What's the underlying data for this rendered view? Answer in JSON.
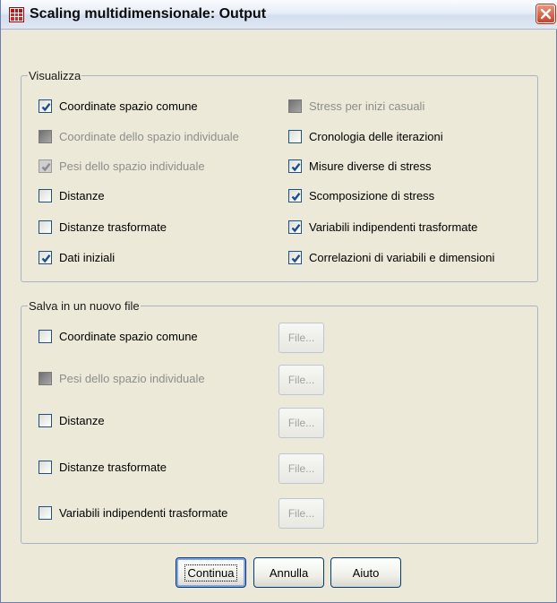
{
  "window": {
    "title": "Scaling multidimensionale: Output"
  },
  "display_group": {
    "label": "Visualizza",
    "left_items": [
      {
        "label": "Coordinate spazio comune",
        "checked": true,
        "enabled": true
      },
      {
        "label": "Coordinate dello spazio individuale",
        "checked": false,
        "enabled": false
      },
      {
        "label": "Pesi dello spazio individuale",
        "checked": true,
        "enabled": false
      },
      {
        "label": "Distanze",
        "checked": false,
        "enabled": true
      },
      {
        "label": "Distanze trasformate",
        "checked": false,
        "enabled": true
      },
      {
        "label": "Dati iniziali",
        "checked": true,
        "enabled": true
      }
    ],
    "right_items": [
      {
        "label": "Stress per inizi casuali",
        "checked": false,
        "enabled": false
      },
      {
        "label": "Cronologia delle iterazioni",
        "checked": false,
        "enabled": true
      },
      {
        "label": "Misure diverse di stress",
        "checked": true,
        "enabled": true
      },
      {
        "label": "Scomposizione di stress",
        "checked": true,
        "enabled": true
      },
      {
        "label": "Variabili indipendenti trasformate",
        "checked": true,
        "enabled": true
      },
      {
        "label": "Correlazioni di variabili e dimensioni",
        "checked": true,
        "enabled": true
      }
    ]
  },
  "save_group": {
    "label": "Salva in un nuovo file",
    "items": [
      {
        "label": "Coordinate spazio comune",
        "checked": false,
        "enabled": true,
        "button": "File..."
      },
      {
        "label": "Pesi dello spazio individuale",
        "checked": false,
        "enabled": false,
        "button": "File..."
      },
      {
        "label": "Distanze",
        "checked": false,
        "enabled": true,
        "button": "File..."
      },
      {
        "label": "Distanze trasformate",
        "checked": false,
        "enabled": true,
        "button": "File..."
      },
      {
        "label": "Variabili indipendenti trasformate",
        "checked": false,
        "enabled": true,
        "button": "File..."
      }
    ]
  },
  "buttons": {
    "continue": "Continua",
    "cancel": "Annulla",
    "help": "Aiuto"
  },
  "colors": {
    "dialog_bg": "#ece9d8",
    "check_mark": "#1c4e8a",
    "close_red": "#c5432a"
  }
}
